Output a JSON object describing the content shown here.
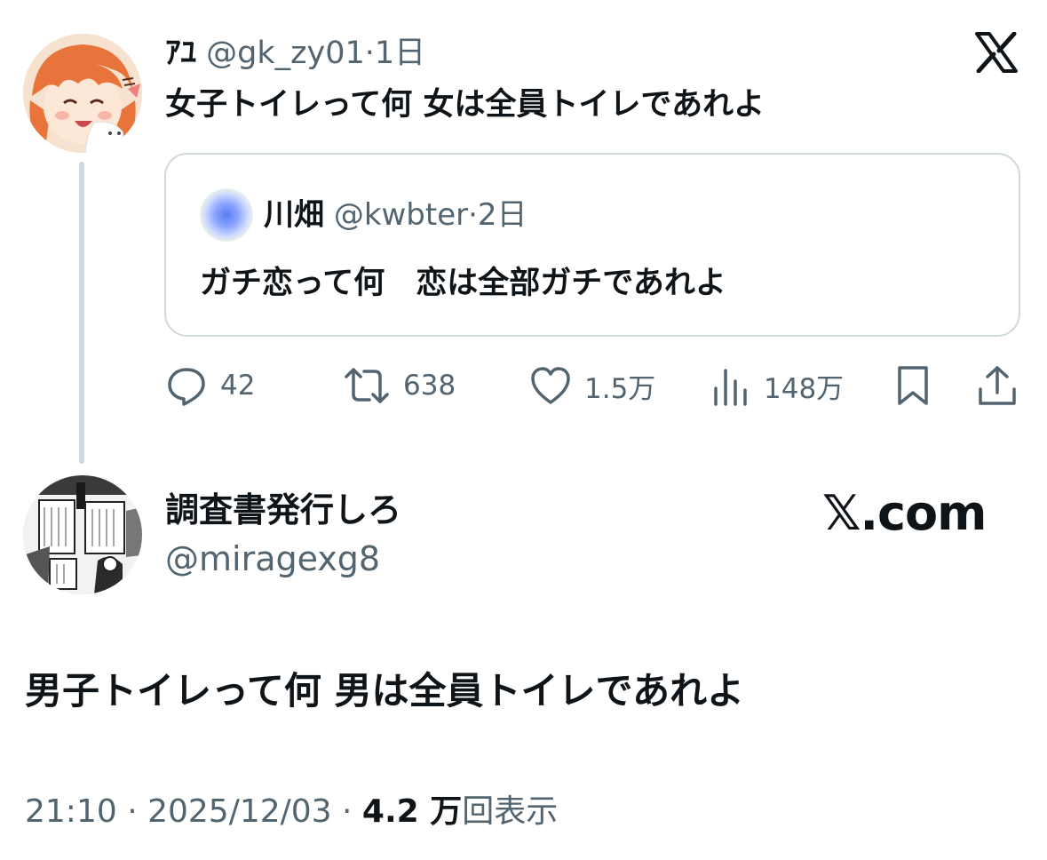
{
  "parent_tweet": {
    "author_name": "ｱﾕ",
    "handle_time": "@gk_zy01·1日",
    "text": "女子トイレって何 女は全員トイレであれよ",
    "quoted": {
      "author_name": "川畑",
      "handle_time": "@kwbter·2日",
      "text": "ガチ恋って何　恋は全部ガチであれよ"
    },
    "stats": {
      "replies": "42",
      "reposts": "638",
      "likes": "1.5万",
      "views": "148万"
    }
  },
  "main_tweet": {
    "author_name": "調査書発行しろ",
    "handle": "@miragexg8",
    "watermark": "𝕏.com",
    "text": "男子トイレって何 男は全員トイレであれよ",
    "time": "21:10 · 2025/12/03 · ",
    "views_count": "4.2 万",
    "views_label": "回表示"
  },
  "colors": {
    "text_primary": "#0f1419",
    "text_secondary": "#536471",
    "border": "#cfd9de"
  },
  "icons": [
    "x-logo-icon",
    "reply-icon",
    "repost-icon",
    "like-icon",
    "views-icon",
    "bookmark-icon",
    "share-icon"
  ]
}
